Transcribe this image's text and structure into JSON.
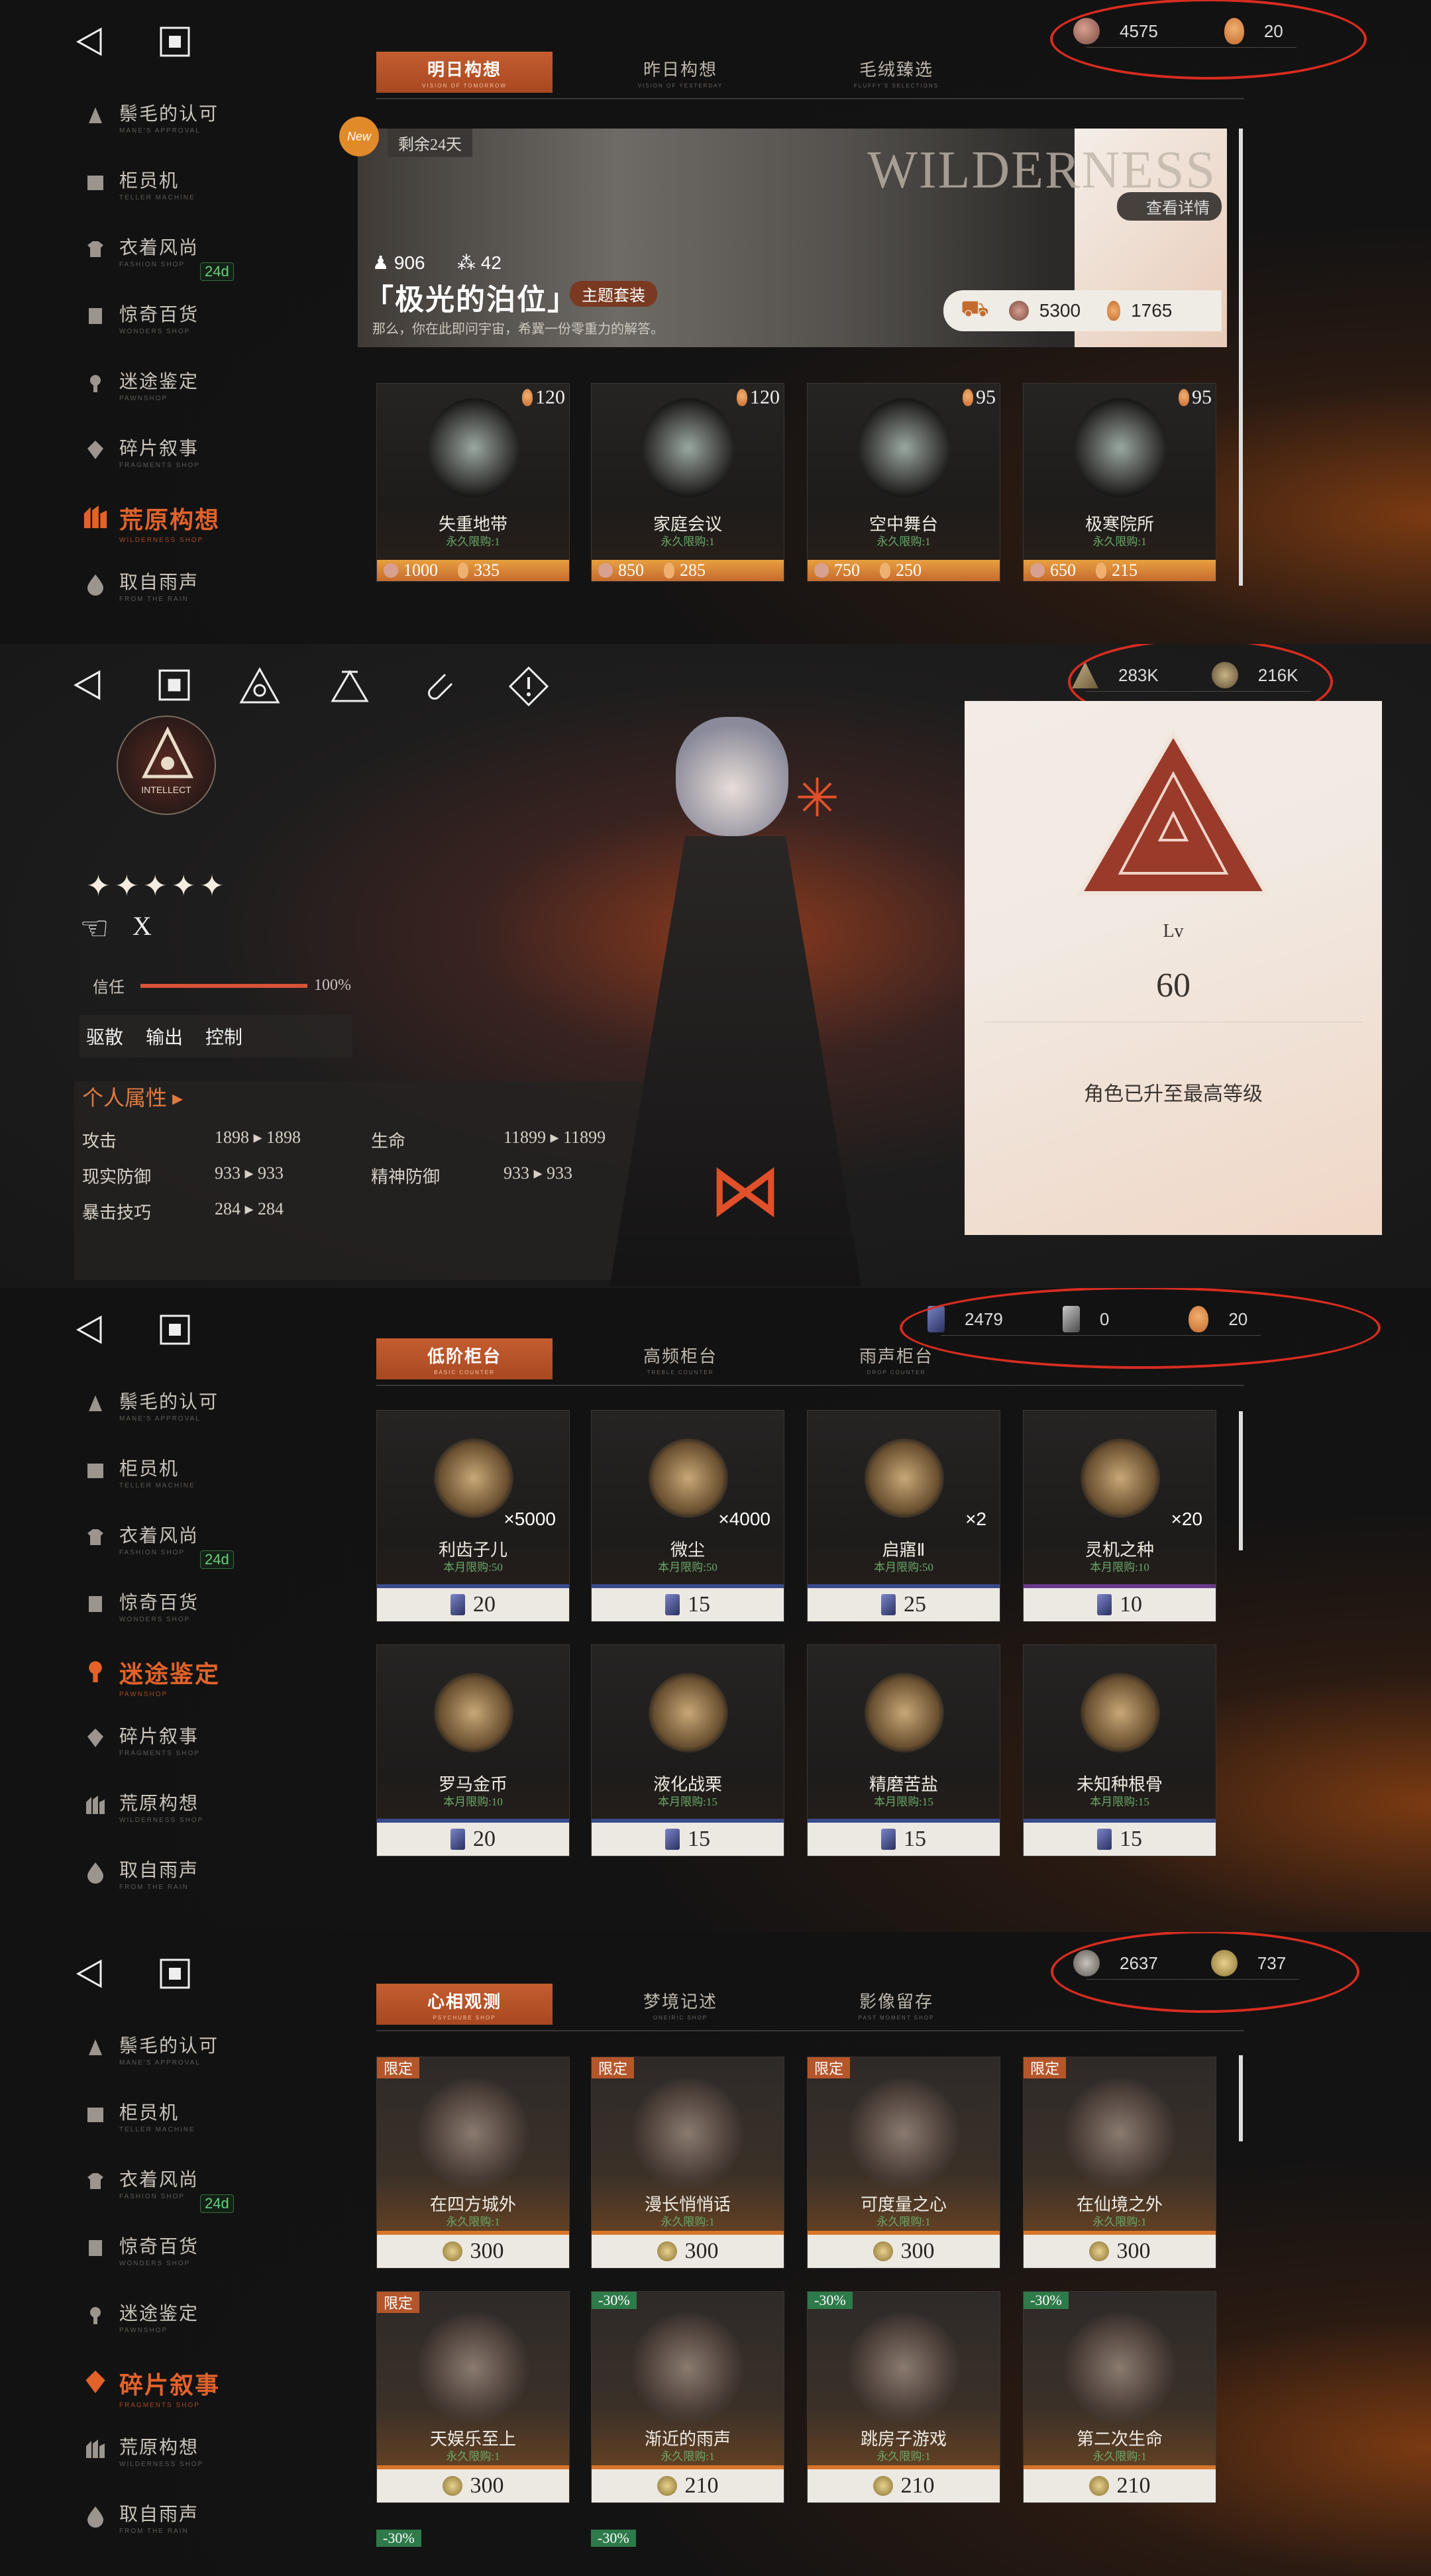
{
  "panel1": {
    "currency": [
      {
        "value": "4575"
      },
      {
        "value": "20"
      }
    ],
    "tabs": [
      {
        "label": "明日构想",
        "sub": "VISION OF TOMORROW"
      },
      {
        "label": "昨日构想",
        "sub": "VISION OF YESTERDAY"
      },
      {
        "label": "毛绒臻选",
        "sub": "FLUFFY'S SELECTIONS"
      }
    ],
    "sidebar": [
      {
        "label": "鬃毛的认可",
        "sub": "MANE'S APPROVAL"
      },
      {
        "label": "柜员机",
        "sub": "TELLER MACHINE"
      },
      {
        "label": "衣着风尚",
        "sub": "FASHION SHOP"
      },
      {
        "label": "惊奇百货",
        "sub": "WONDERS SHOP"
      },
      {
        "label": "迷途鉴定",
        "sub": "PAWNSHOP"
      },
      {
        "label": "碎片叙事",
        "sub": "FRAGMENTS SHOP"
      },
      {
        "label": "荒原构想",
        "sub": "WILDERNESS SHOP"
      },
      {
        "label": "取自雨声",
        "sub": "FROM THE RAIN"
      }
    ],
    "badge": "24d",
    "banner": {
      "new": "New",
      "days": "剩余24天",
      "brand": "WILDERNESS",
      "view_detail": "查看详情",
      "stat1": "906",
      "stat2": "42",
      "title": "「极光的泊位」",
      "theme_pack": "主题套装",
      "desc": "那么，你在此即问宇宙，希冀一份零重力的解答。",
      "price1": "5300",
      "price2": "1765"
    },
    "cards": [
      {
        "name": "失重地带",
        "limit": "永久限购:1",
        "corner": "120",
        "p1": "1000",
        "p2": "335"
      },
      {
        "name": "家庭会议",
        "limit": "永久限购:1",
        "corner": "120",
        "p1": "850",
        "p2": "285"
      },
      {
        "name": "空中舞台",
        "limit": "永久限购:1",
        "corner": "95",
        "p1": "750",
        "p2": "250"
      },
      {
        "name": "极寒院所",
        "limit": "永久限购:1",
        "corner": "95",
        "p1": "650",
        "p2": "215"
      }
    ]
  },
  "panel2": {
    "currency": [
      {
        "value": "283K"
      },
      {
        "value": "216K"
      }
    ],
    "badge_top": "INTELLECT",
    "stars": "✦✦✦✦✦",
    "name": "X",
    "trust_label": "信任",
    "trust_value": "100%",
    "trust_fraction": 1.0,
    "roles": [
      "驱散",
      "输出",
      "控制"
    ],
    "attr_title": "个人属性 ▸",
    "attrs": [
      {
        "label": "攻击",
        "value": "1898 ▸ 1898"
      },
      {
        "label": "生命",
        "value": "11899 ▸ 11899"
      },
      {
        "label": "现实防御",
        "value": "933 ▸ 933"
      },
      {
        "label": "精神防御",
        "value": "933 ▸ 933"
      },
      {
        "label": "暴击技巧",
        "value": "284 ▸ 284"
      }
    ],
    "level_label": "Lv",
    "level": "60",
    "max_msg": "角色已升至最高等级"
  },
  "panel3": {
    "currency": [
      {
        "value": "2479"
      },
      {
        "value": "0"
      },
      {
        "value": "20"
      }
    ],
    "tabs": [
      {
        "label": "低阶柜台",
        "sub": "BASIC COUNTER"
      },
      {
        "label": "高频柜台",
        "sub": "TREBLE COUNTER"
      },
      {
        "label": "雨声柜台",
        "sub": "DROP COUNTER"
      }
    ],
    "sidebar": [
      {
        "label": "鬃毛的认可",
        "sub": "MANE'S APPROVAL"
      },
      {
        "label": "柜员机",
        "sub": "TELLER MACHINE"
      },
      {
        "label": "衣着风尚",
        "sub": "FASHION SHOP"
      },
      {
        "label": "惊奇百货",
        "sub": "WONDERS SHOP"
      },
      {
        "label": "迷途鉴定",
        "sub": "PAWNSHOP"
      },
      {
        "label": "碎片叙事",
        "sub": "FRAGMENTS SHOP"
      },
      {
        "label": "荒原构想",
        "sub": "WILDERNESS SHOP"
      },
      {
        "label": "取自雨声",
        "sub": "FROM THE RAIN"
      }
    ],
    "badge": "24d",
    "cards": [
      {
        "name": "利齿子儿",
        "limit": "本月限购:50",
        "qty": "×5000",
        "price": "20"
      },
      {
        "name": "微尘",
        "limit": "本月限购:50",
        "qty": "×4000",
        "price": "15"
      },
      {
        "name": "启寤Ⅱ",
        "limit": "本月限购:50",
        "qty": "×2",
        "price": "25"
      },
      {
        "name": "灵机之种",
        "limit": "本月限购:10",
        "qty": "×20",
        "price": "10"
      },
      {
        "name": "罗马金币",
        "limit": "本月限购:10",
        "qty": "",
        "price": "20"
      },
      {
        "name": "液化战栗",
        "limit": "本月限购:15",
        "qty": "",
        "price": "15"
      },
      {
        "name": "精磨苦盐",
        "limit": "本月限购:15",
        "qty": "",
        "price": "15"
      },
      {
        "name": "未知种根骨",
        "limit": "本月限购:15",
        "qty": "",
        "price": "15"
      }
    ]
  },
  "panel4": {
    "currency": [
      {
        "value": "2637"
      },
      {
        "value": "737"
      }
    ],
    "tabs": [
      {
        "label": "心相观测",
        "sub": "PSYCHUBE SHOP"
      },
      {
        "label": "梦境记述",
        "sub": "ONEIRIC SHOP"
      },
      {
        "label": "影像留存",
        "sub": "PAST MOMENT SHOP"
      }
    ],
    "sidebar": [
      {
        "label": "鬃毛的认可",
        "sub": "MANE'S APPROVAL"
      },
      {
        "label": "柜员机",
        "sub": "TELLER MACHINE"
      },
      {
        "label": "衣着风尚",
        "sub": "FASHION SHOP"
      },
      {
        "label": "惊奇百货",
        "sub": "WONDERS SHOP"
      },
      {
        "label": "迷途鉴定",
        "sub": "PAWNSHOP"
      },
      {
        "label": "碎片叙事",
        "sub": "FRAGMENTS SHOP"
      },
      {
        "label": "荒原构想",
        "sub": "WILDERNESS SHOP"
      },
      {
        "label": "取自雨声",
        "sub": "FROM THE RAIN"
      }
    ],
    "badge": "24d",
    "cards": [
      {
        "tag": "限定",
        "tagtype": "limited",
        "name": "在四方城外",
        "limit": "永久限购:1",
        "price": "300"
      },
      {
        "tag": "限定",
        "tagtype": "limited",
        "name": "漫长悄悄话",
        "limit": "永久限购:1",
        "price": "300"
      },
      {
        "tag": "限定",
        "tagtype": "limited",
        "name": "可度量之心",
        "limit": "永久限购:1",
        "price": "300"
      },
      {
        "tag": "限定",
        "tagtype": "limited",
        "name": "在仙境之外",
        "limit": "永久限购:1",
        "price": "300"
      },
      {
        "tag": "限定",
        "tagtype": "limited",
        "name": "天娱乐至上",
        "limit": "永久限购:1",
        "price": "300"
      },
      {
        "tag": "-30%",
        "tagtype": "discount",
        "name": "渐近的雨声",
        "limit": "永久限购:1",
        "price": "210"
      },
      {
        "tag": "-30%",
        "tagtype": "discount",
        "name": "跳房子游戏",
        "limit": "永久限购:1",
        "price": "210"
      },
      {
        "tag": "-30%",
        "tagtype": "discount",
        "name": "第二次生命",
        "limit": "永久限购:1",
        "price": "210"
      }
    ],
    "bottom_tags": [
      "-30%",
      "-30%"
    ]
  },
  "colors": {
    "accent": "#c45d30",
    "highlight": "#e2622a",
    "ellipse": "#d82c20",
    "limit_green": "#6aa86a"
  }
}
